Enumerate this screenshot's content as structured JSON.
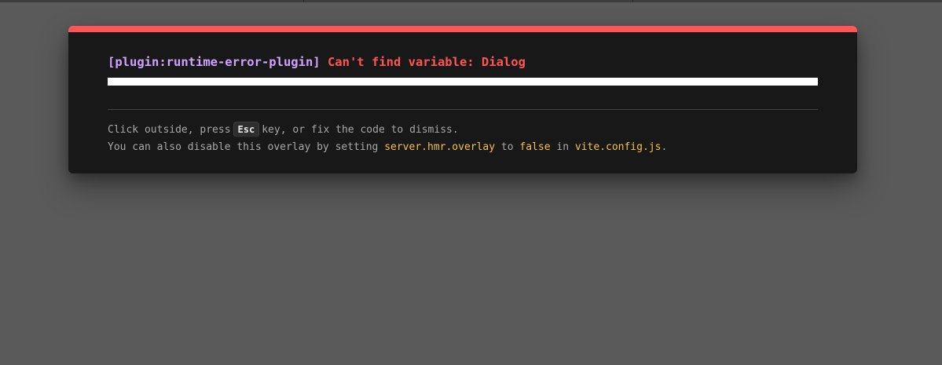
{
  "overlay": {
    "plugin": "[plugin:runtime-error-plugin]",
    "message": "Can't find variable: Dialog",
    "tip_line1": {
      "before": "Click outside, press",
      "key": "Esc",
      "after": "key, or fix the code to dismiss."
    },
    "tip_line2": {
      "prefix": "You can also disable this overlay by setting",
      "setting": "server.hmr.overlay",
      "to": "to",
      "value": "false",
      "in": "in",
      "file": "vite.config.js",
      "suffix": "."
    }
  },
  "colors": {
    "accent": "#ff5555",
    "plugin": "#cfa4ff",
    "code": "#f3c14c",
    "backdrop": "#5a5a5a",
    "window": "#181818"
  }
}
